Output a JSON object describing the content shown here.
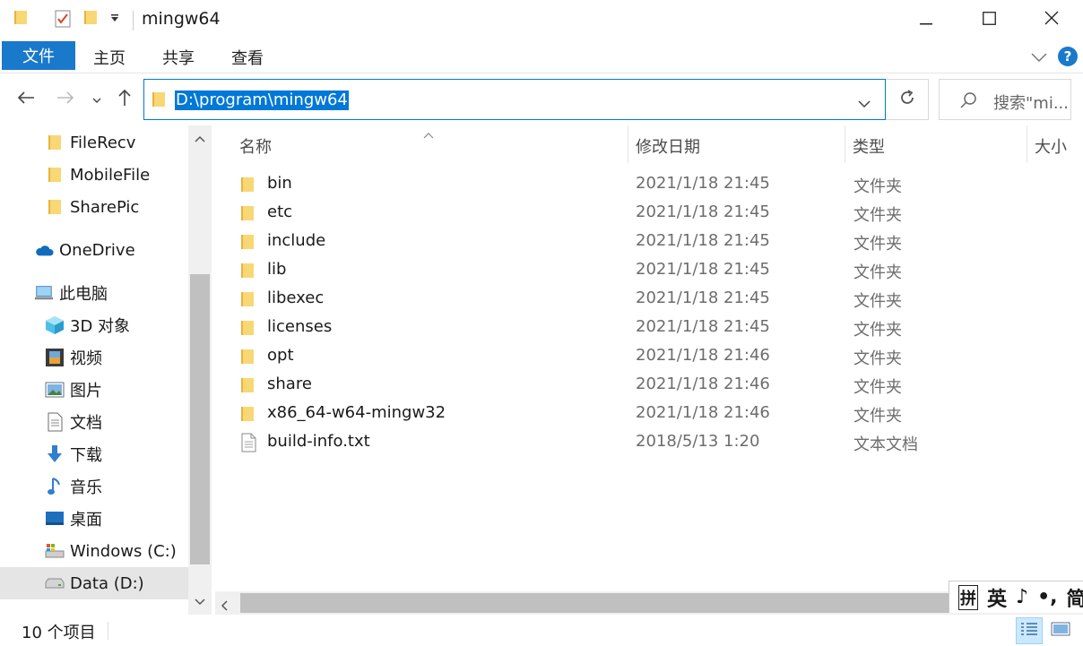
{
  "window": {
    "title": "mingw64",
    "minimize_icon": "minimize-icon",
    "maximize_icon": "maximize-icon",
    "close_icon": "close-icon"
  },
  "ribbon": {
    "tabs": [
      "文件",
      "主页",
      "共享",
      "查看"
    ]
  },
  "address": {
    "path": "D:\\program\\mingw64"
  },
  "search": {
    "placeholder": "搜索\"mi..."
  },
  "sidebar": {
    "items": [
      {
        "label": "FileRecv",
        "icon": "folder-icon"
      },
      {
        "label": "MobileFile",
        "icon": "folder-icon"
      },
      {
        "label": "SharePic",
        "icon": "folder-icon"
      },
      {
        "label": "OneDrive",
        "icon": "cloud-icon"
      },
      {
        "label": "此电脑",
        "icon": "computer-icon"
      },
      {
        "label": "3D 对象",
        "icon": "cube-icon"
      },
      {
        "label": "视频",
        "icon": "video-icon"
      },
      {
        "label": "图片",
        "icon": "picture-icon"
      },
      {
        "label": "文档",
        "icon": "document-icon"
      },
      {
        "label": "下载",
        "icon": "download-icon"
      },
      {
        "label": "音乐",
        "icon": "music-icon"
      },
      {
        "label": "桌面",
        "icon": "desktop-icon"
      },
      {
        "label": "Windows (C:)",
        "icon": "drive-c-icon"
      },
      {
        "label": "Data (D:)",
        "icon": "drive-icon"
      }
    ]
  },
  "columns": {
    "name": "名称",
    "modified": "修改日期",
    "type": "类型",
    "size": "大小"
  },
  "files": [
    {
      "name": "bin",
      "modified": "2021/1/18 21:45",
      "type": "文件夹",
      "kind": "folder"
    },
    {
      "name": "etc",
      "modified": "2021/1/18 21:45",
      "type": "文件夹",
      "kind": "folder"
    },
    {
      "name": "include",
      "modified": "2021/1/18 21:45",
      "type": "文件夹",
      "kind": "folder"
    },
    {
      "name": "lib",
      "modified": "2021/1/18 21:45",
      "type": "文件夹",
      "kind": "folder"
    },
    {
      "name": "libexec",
      "modified": "2021/1/18 21:45",
      "type": "文件夹",
      "kind": "folder"
    },
    {
      "name": "licenses",
      "modified": "2021/1/18 21:45",
      "type": "文件夹",
      "kind": "folder"
    },
    {
      "name": "opt",
      "modified": "2021/1/18 21:46",
      "type": "文件夹",
      "kind": "folder"
    },
    {
      "name": "share",
      "modified": "2021/1/18 21:46",
      "type": "文件夹",
      "kind": "folder"
    },
    {
      "name": "x86_64-w64-mingw32",
      "modified": "2021/1/18 21:46",
      "type": "文件夹",
      "kind": "folder"
    },
    {
      "name": "build-info.txt",
      "modified": "2018/5/13 1:20",
      "type": "文本文档",
      "kind": "text-file"
    }
  ],
  "ime": {
    "items": [
      "拼",
      "英",
      "♪",
      "•,",
      "简"
    ]
  },
  "status": {
    "count": "10 个项目"
  },
  "colors": {
    "accent": "#1979ca",
    "selection": "#0078d7",
    "folder": "#f8d775"
  }
}
